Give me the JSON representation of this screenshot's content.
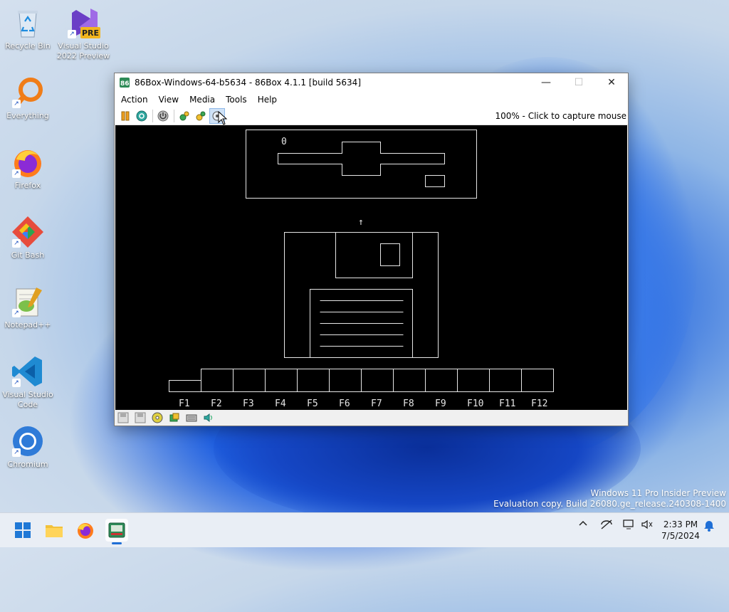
{
  "desktop": {
    "icons": [
      {
        "label": "Recycle Bin",
        "icon": "recycle-bin-icon"
      },
      {
        "label": "Visual Studio 2022 Preview",
        "icon": "visual-studio-icon",
        "badge": "PRE"
      },
      {
        "label": "Everything",
        "icon": "everything-search-icon"
      },
      {
        "label": "Firefox",
        "icon": "firefox-icon"
      },
      {
        "label": "Git Bash",
        "icon": "git-bash-icon"
      },
      {
        "label": "Notepad++",
        "icon": "notepad-plus-plus-icon"
      },
      {
        "label": "Visual Studio Code",
        "icon": "vscode-icon"
      },
      {
        "label": "Chromium",
        "icon": "chromium-icon"
      }
    ],
    "watermark_line1": "Windows 11 Pro Insider Preview",
    "watermark_line2": "Evaluation copy. Build 26080.ge_release.240308-1400"
  },
  "window": {
    "title": "86Box-Windows-64-b5634 - 86Box 4.1.1 [build 5634]",
    "minimize": "—",
    "maximize": "☐",
    "close": "✕",
    "menu": [
      "Action",
      "View",
      "Media",
      "Tools",
      "Help"
    ],
    "toolbar_icons": [
      "pause-icon",
      "ctrl-alt-del-icon",
      "power-icon",
      "settings-icon",
      "hard-reset-icon",
      "capture-mouse-icon"
    ],
    "capture_text": "100% - Click to capture mouse",
    "status_icons": [
      "floppy-a-icon",
      "floppy-b-icon",
      "cdrom-icon",
      "hard-disk-icon",
      "keyboard-icon",
      "sound-icon"
    ]
  },
  "emulated_screen": {
    "counter": "0",
    "arrow": "↑",
    "function_keys": [
      "F1",
      "F2",
      "F3",
      "F4",
      "F5",
      "F6",
      "F7",
      "F8",
      "F9",
      "F10",
      "F11",
      "F12"
    ]
  },
  "taskbar": {
    "apps": [
      "start-icon",
      "file-explorer-icon",
      "firefox-icon",
      "86box-icon"
    ],
    "tray_icons": [
      "chevron-up-icon",
      "network-off-icon",
      "display-icon",
      "volume-icon"
    ],
    "time": "2:33 PM",
    "date": "7/5/2024"
  },
  "colors": {
    "accent": "#1f6fd6",
    "screen_bg": "#000000",
    "screen_fg": "#e6e6e6"
  }
}
